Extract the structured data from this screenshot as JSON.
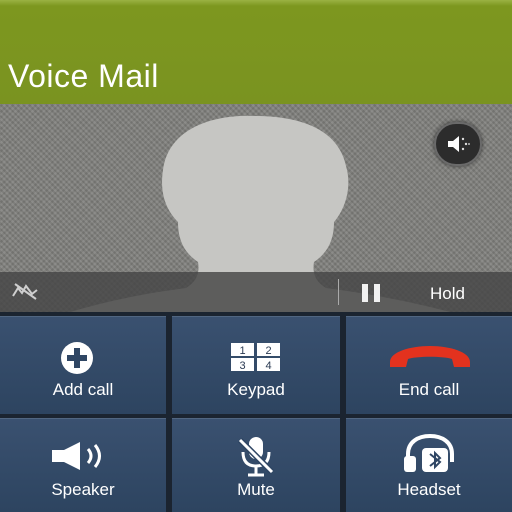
{
  "call": {
    "title": "Voice Mail"
  },
  "hold": {
    "label": "Hold"
  },
  "actions": [
    {
      "id": "add-call",
      "label": "Add call",
      "icon": "add-call-icon"
    },
    {
      "id": "keypad",
      "label": "Keypad",
      "icon": "keypad-icon"
    },
    {
      "id": "end-call",
      "label": "End call",
      "icon": "end-call-icon"
    },
    {
      "id": "speaker",
      "label": "Speaker",
      "icon": "speaker-icon"
    },
    {
      "id": "mute",
      "label": "Mute",
      "icon": "mute-icon"
    },
    {
      "id": "headset",
      "label": "Headset",
      "icon": "bluetooth-headset-icon"
    }
  ],
  "keypad_digits": [
    "1",
    "2",
    "3",
    "4"
  ],
  "colors": {
    "header": "#7a9320",
    "end_call": "#e3321e",
    "button": "#33496a"
  }
}
